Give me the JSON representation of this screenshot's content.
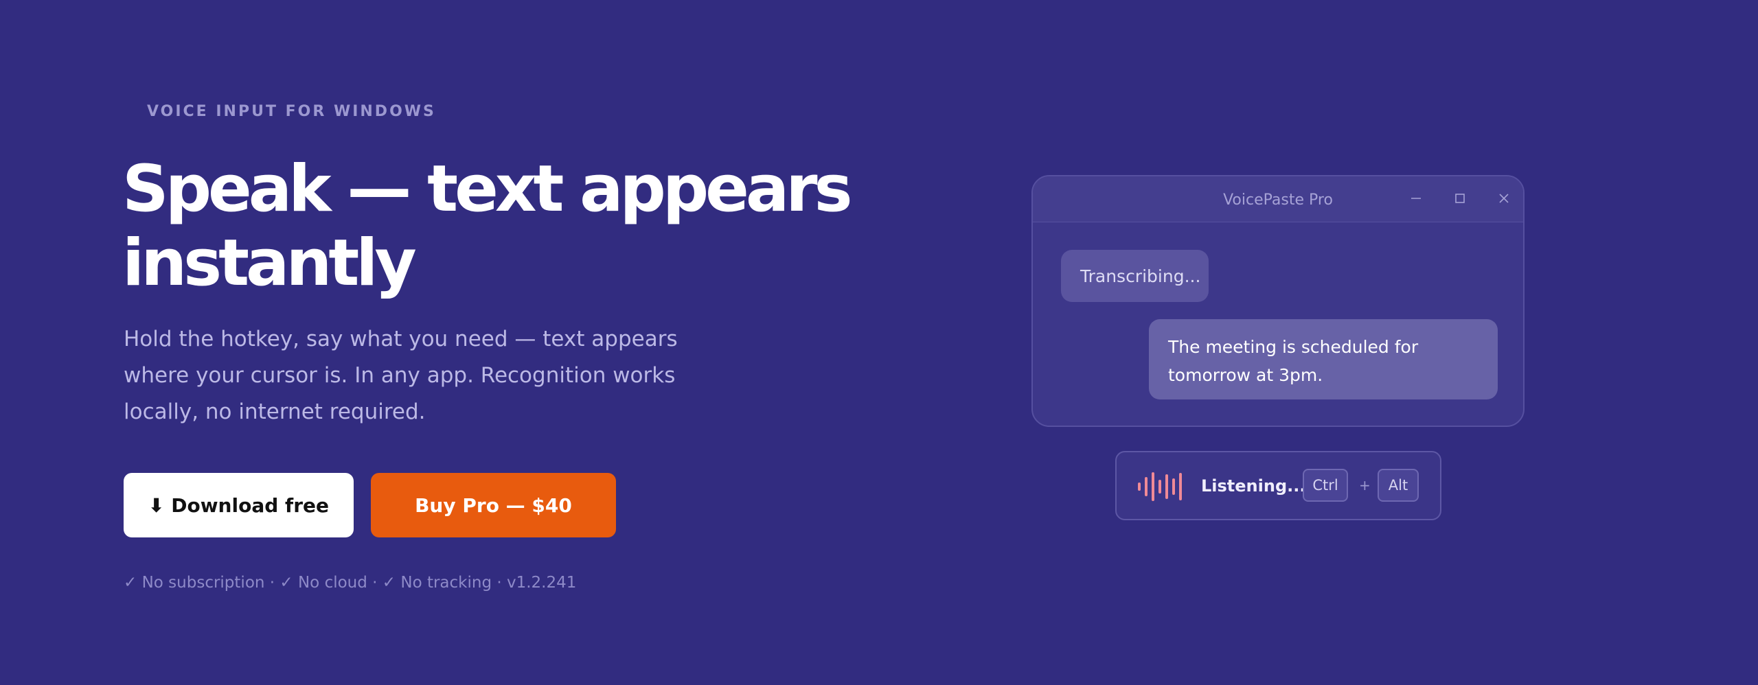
{
  "hero": {
    "eyebrow": "VOICE INPUT FOR WINDOWS",
    "headline": "Speak — text appears instantly",
    "subtitle": "Hold the hotkey, say what you need — text appears where your cursor is. In any app. Recognition works locally, no internet required.",
    "download_label": "⬇ Download free",
    "buy_label": "Buy Pro — $40",
    "features": "✓ No subscription · ✓ No cloud · ✓ No tracking · v1.2.241"
  },
  "app_window": {
    "title": "VoicePaste Pro",
    "status_bubble": "Transcribing...",
    "message_bubble": "The meeting is scheduled for tomorrow at 3pm.",
    "controls": [
      "minimize-icon",
      "maximize-icon",
      "close-icon"
    ]
  },
  "listening_bar": {
    "label": "Listening...",
    "hotkey": [
      "Ctrl",
      "Alt"
    ],
    "separator": "+",
    "wave_icon": "waveform-icon"
  },
  "colors": {
    "background": "#322c80",
    "accent_orange": "#e85b0e",
    "download_bg": "#ffffff",
    "wave": "#f08a96",
    "muted_text": "#bcb9e6"
  }
}
